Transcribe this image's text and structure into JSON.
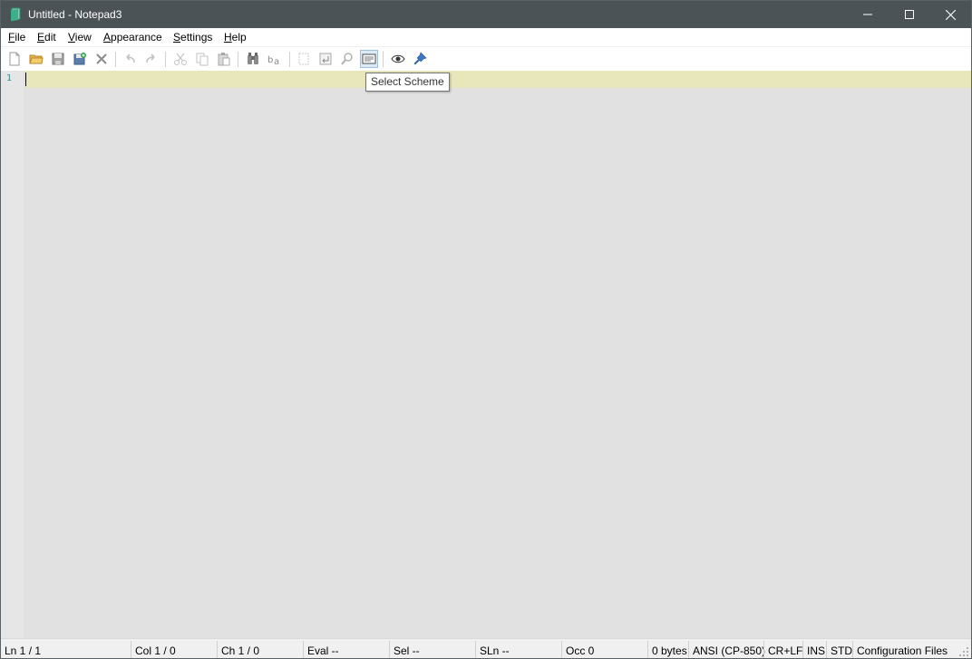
{
  "window": {
    "title": "Untitled - Notepad3",
    "icons": {
      "app": "notepad3-app-icon",
      "minimize": "minimize-icon",
      "maximize": "maximize-icon",
      "close": "close-icon"
    }
  },
  "menu": [
    {
      "underline": "F",
      "rest": "ile"
    },
    {
      "underline": "E",
      "rest": "dit"
    },
    {
      "underline": "V",
      "rest": "iew"
    },
    {
      "underline": "A",
      "rest": "ppearance"
    },
    {
      "underline": "S",
      "rest": "ettings"
    },
    {
      "underline": "H",
      "rest": "elp"
    }
  ],
  "toolbar": {
    "icons": [
      "new-file-icon",
      "open-folder-icon",
      "save-icon",
      "save-as-icon",
      "close-file-icon",
      "undo-icon",
      "redo-icon",
      "cut-icon",
      "copy-icon",
      "paste-icon",
      "find-icon",
      "replace-icon",
      "word-wrap-icon",
      "long-line-icon",
      "zoom-icon",
      "select-scheme-icon",
      "view-eye-icon",
      "pin-icon"
    ],
    "active": "select-scheme-icon",
    "tooltip": "Select Scheme"
  },
  "editor": {
    "line_numbers": [
      "1"
    ],
    "content": ""
  },
  "statusbar": {
    "ln": "Ln  1 / 1",
    "col": "Col  1 / 0",
    "ch": "Ch  1 / 0",
    "eval": "Eval  --",
    "sel": "Sel  --",
    "sln": "SLn  --",
    "occ": "Occ  0",
    "size": "0 bytes",
    "encoding": "ANSI (CP-850)",
    "eol": "CR+LF",
    "ovr": "INS",
    "mode": "STD",
    "lexer": "Configuration Files"
  },
  "colors": {
    "titlebar": "#4b5357",
    "current_line": "#e8e6bb",
    "editor_bg": "#e1e1e1",
    "line_number": "#2b8d8f"
  }
}
